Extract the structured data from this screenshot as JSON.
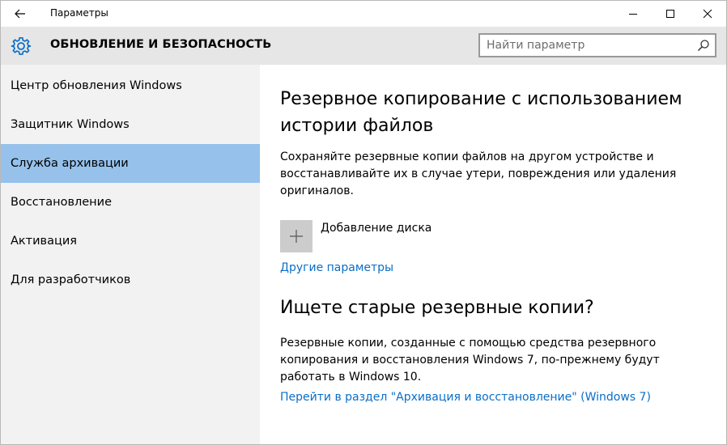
{
  "window": {
    "title": "Параметры"
  },
  "header": {
    "section_title": "ОБНОВЛЕНИЕ И БЕЗОПАСНОСТЬ",
    "search_placeholder": "Найти параметр"
  },
  "sidebar": {
    "items": [
      {
        "label": "Центр обновления Windows",
        "selected": false
      },
      {
        "label": "Защитник Windows",
        "selected": false
      },
      {
        "label": "Служба архивации",
        "selected": true
      },
      {
        "label": "Восстановление",
        "selected": false
      },
      {
        "label": "Активация",
        "selected": false
      },
      {
        "label": "Для разработчиков",
        "selected": false
      }
    ]
  },
  "main": {
    "heading": "Резервное копирование с использованием истории файлов",
    "description": "Сохраняйте резервные копии файлов на другом устройстве и восстанавливайте их в случае утери, повреждения или удаления оригиналов.",
    "add_drive_label": "Добавление диска",
    "more_options_link": "Другие параметры",
    "old_backups_heading": "Ищете старые резервные копии?",
    "old_backups_text": "Резервные копии, созданные с помощью средства резервного копирования и восстановления Windows 7, по-прежнему будут работать в Windows 10.",
    "win7_link": "Перейти в раздел \"Архивация и восстановление\" (Windows 7)"
  },
  "colors": {
    "accent": "#0a6ec8",
    "selected_nav": "#95c1eb",
    "header_band": "#e6e6e6",
    "sidebar_bg": "#f2f2f2",
    "tile_bg": "#cccccc"
  },
  "icons": {
    "back": "back-arrow-icon",
    "settings": "gear-icon",
    "search": "search-icon",
    "add": "plus-icon",
    "minimize": "minimize-icon",
    "maximize": "maximize-icon",
    "close": "close-icon"
  }
}
